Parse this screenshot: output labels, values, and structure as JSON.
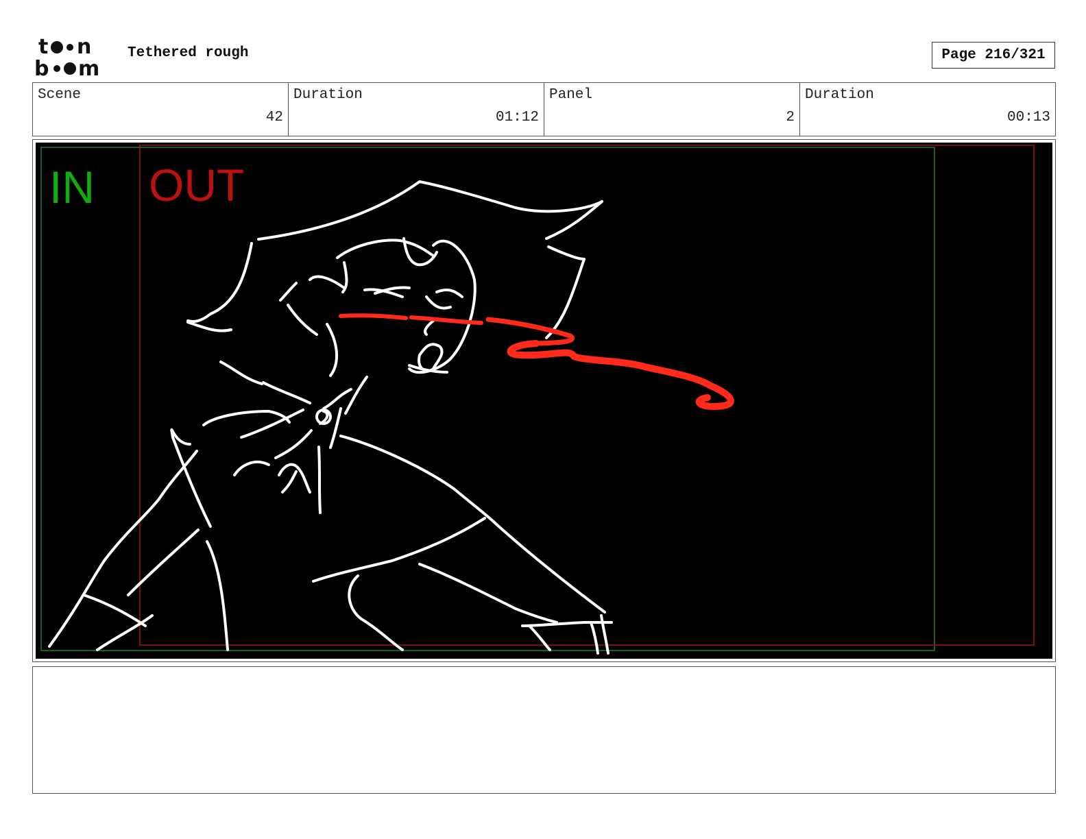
{
  "header": {
    "logo": {
      "text_line1": "toon",
      "text_line2": "boom"
    },
    "title": "Tethered rough",
    "page_label": "Page 216/321"
  },
  "info": [
    {
      "label": "Scene",
      "value": "42"
    },
    {
      "label": "Duration",
      "value": "01:12"
    },
    {
      "label": "Panel",
      "value": "2"
    },
    {
      "label": "Duration",
      "value": "00:13"
    }
  ],
  "panel": {
    "background": "#000000",
    "in_label": "IN",
    "out_label": "OUT",
    "in_color": "#11aa11",
    "out_color": "#bb1111",
    "sketch_color": "#ffffff",
    "accent_color": "#ff2a1a"
  },
  "notes": {
    "text": ""
  }
}
